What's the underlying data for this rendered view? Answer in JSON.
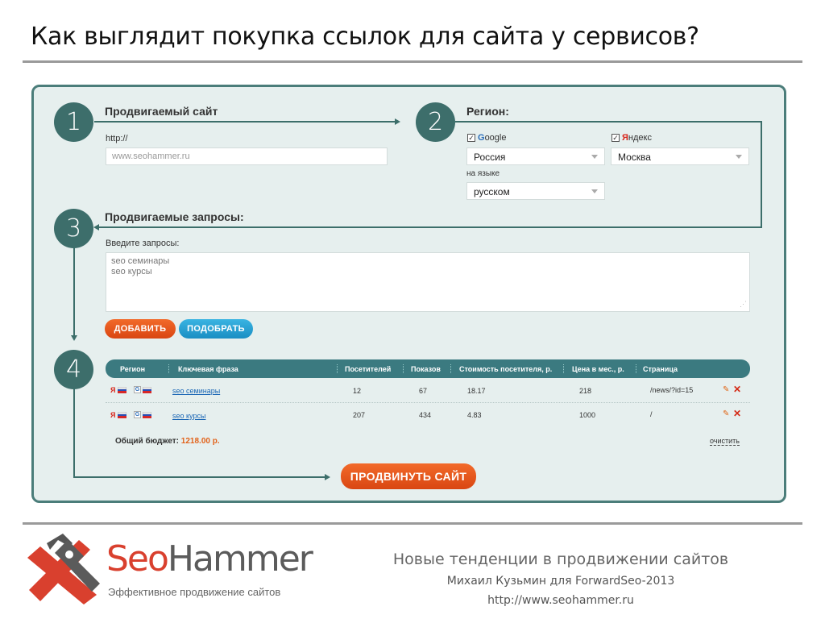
{
  "slide": {
    "title": "Как выглядит покупка ссылок для сайта у сервисов?"
  },
  "steps": [
    "1",
    "2",
    "3",
    "4"
  ],
  "site": {
    "heading": "Продвигаемый сайт",
    "protocol_label": "http://",
    "url_placeholder": "www.seohammer.ru"
  },
  "region": {
    "heading": "Регион:",
    "google_label_first": "G",
    "google_label_rest": "oogle",
    "google_checked": true,
    "yandex_label_first": "Я",
    "yandex_label_rest": "ндекс",
    "yandex_checked": true,
    "country_value": "Россия",
    "city_value": "Москва",
    "language_label": "на языке",
    "language_value": "русском"
  },
  "queries": {
    "heading": "Продвигаемые запросы:",
    "input_label": "Введите запросы:",
    "lines": [
      "seo семинары",
      "seo курсы"
    ]
  },
  "buttons": {
    "add": "ДОБАВИТЬ",
    "pick": "ПОДОБРАТЬ",
    "promote": "ПРОДВИНУТЬ САЙТ"
  },
  "table": {
    "headers": {
      "region": "Регион",
      "phrase": "Ключевая фраза",
      "visitors": "Посетителей",
      "impressions": "Показов",
      "cost_per_visitor": "Стоимость посетителя, р.",
      "price_month": "Цена в мес., р.",
      "page": "Страница"
    },
    "rows": [
      {
        "phrase": "seo семинары",
        "visitors": "12",
        "impressions": "67",
        "cost_per_visitor": "18.17",
        "price_month": "218",
        "page": "/news/?id=15"
      },
      {
        "phrase": "seo курсы",
        "visitors": "207",
        "impressions": "434",
        "cost_per_visitor": "4.83",
        "price_month": "1000",
        "page": "/"
      }
    ],
    "icons": {
      "yandex": "Я",
      "google": "G",
      "edit": "✎",
      "delete": "✕"
    }
  },
  "budget": {
    "label": "Общий бюджет:",
    "value": "1218.00 р.",
    "clear_label": "очистить"
  },
  "brand": {
    "logo_seo": "Seo",
    "logo_hammer": "Hammer",
    "tagline": "Эффективное продвижение сайтов"
  },
  "footer": {
    "line1": "Новые тенденции в продвижении сайтов",
    "line2": "Михаил Кузьмин для ForwardSeo-2013",
    "line3": "http://www.seohammer.ru"
  },
  "colors": {
    "accent_teal": "#3d6e6b",
    "button_orange": "#e2561a",
    "button_blue": "#2aa3d6",
    "table_header": "#3b7a80",
    "logo_red": "#d9402e"
  }
}
